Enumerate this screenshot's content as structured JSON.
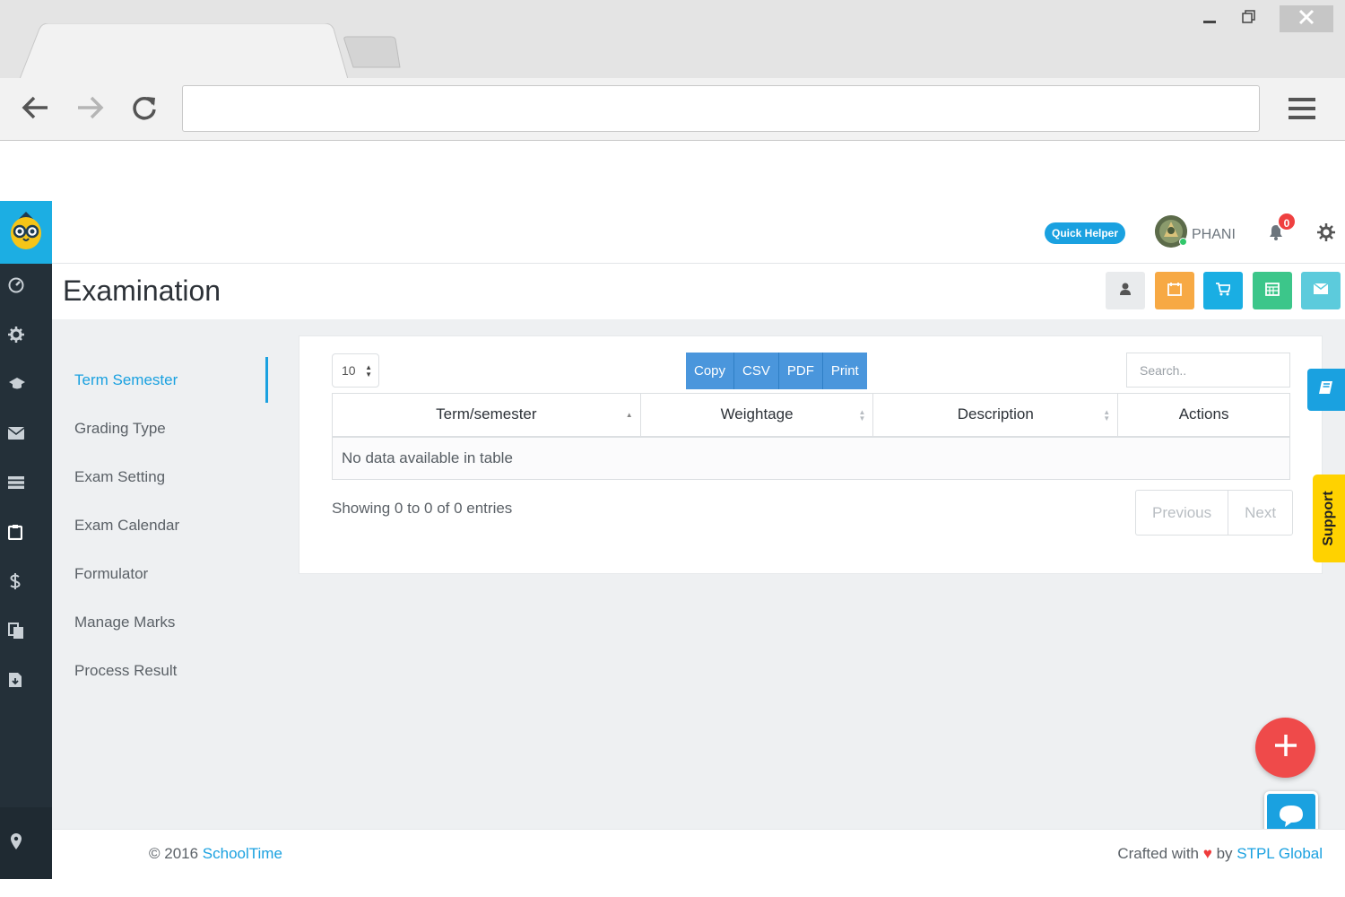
{
  "browser": {
    "url": "",
    "icons": [
      "back-arrow-icon",
      "forward-arrow-icon",
      "reload-icon",
      "hamburger-menu-icon",
      "minimize-icon",
      "restore-icon",
      "close-icon"
    ]
  },
  "topbar": {
    "quick_helper_label": "Quick Helper",
    "username": "PHANI",
    "notification_count": "0"
  },
  "header": {
    "title": "Examination",
    "action_buttons": [
      {
        "name": "user-icon",
        "color": "#e9ebed"
      },
      {
        "name": "calendar-icon",
        "color": "#f7a944"
      },
      {
        "name": "cart-icon",
        "color": "#1aaee3"
      },
      {
        "name": "calendar-grid-icon",
        "color": "#3cc68a"
      },
      {
        "name": "envelope-icon",
        "color": "#5ccbdc"
      }
    ]
  },
  "subnav": {
    "items": [
      {
        "label": "Term Semester",
        "active": true
      },
      {
        "label": "Grading Type"
      },
      {
        "label": "Exam Setting"
      },
      {
        "label": "Exam Calendar"
      },
      {
        "label": "Formulator"
      },
      {
        "label": "Manage Marks"
      },
      {
        "label": "Process Result"
      }
    ]
  },
  "table_controls": {
    "page_length": "10",
    "export_buttons": [
      "Copy",
      "CSV",
      "PDF",
      "Print"
    ],
    "search_placeholder": "Search.."
  },
  "table": {
    "columns": [
      "Term/semester",
      "Weightage",
      "Description",
      "Actions"
    ],
    "empty_message": "No data available in table",
    "info": "Showing 0 to 0 of 0 entries",
    "pagination": {
      "previous": "Previous",
      "next": "Next"
    }
  },
  "floating": {
    "support_label": "Support"
  },
  "footer": {
    "copyright": "© 2016 ",
    "brand": "SchoolTime",
    "crafted_prefix": "Crafted with ",
    "crafted_by": " by ",
    "company": "STPL Global"
  },
  "colors": {
    "accent": "#1aa1e0",
    "sidebar": "#243039",
    "fab": "#ef4a4a",
    "support": "#ffd200"
  }
}
